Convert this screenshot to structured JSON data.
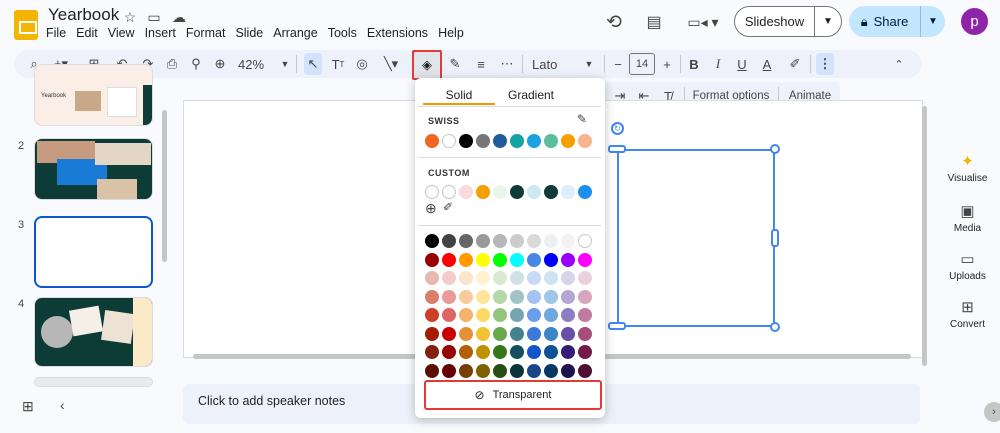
{
  "app": {
    "title": "Yearbook",
    "menu": [
      "File",
      "Edit",
      "View",
      "Insert",
      "Format",
      "Slide",
      "Arrange",
      "Tools",
      "Extensions",
      "Help"
    ]
  },
  "header": {
    "slideshow_label": "Slideshow",
    "share_label": "Share",
    "avatar_letter": "p"
  },
  "toolbar": {
    "zoom": "42%",
    "font": "Lato",
    "font_size": "14"
  },
  "ribbon": {
    "format_options": "Format options",
    "animate": "Animate"
  },
  "slides": {
    "numbers": [
      "2",
      "3",
      "4"
    ]
  },
  "notes": {
    "placeholder": "Click to add speaker notes"
  },
  "sidebar": {
    "items": [
      "Visualise",
      "Media",
      "Uploads",
      "Convert"
    ]
  },
  "color_popup": {
    "tab_solid": "Solid",
    "tab_gradient": "Gradient",
    "section_theme": "SWISS",
    "section_custom": "CUSTOM",
    "transparent_label": "Transparent",
    "theme_colors": [
      "#f26522",
      "#ffffff",
      "#000000",
      "#777777",
      "#1f5c99",
      "#14a3a3",
      "#1aa3e0",
      "#5cbd9b",
      "#f5a000",
      "#f7b48f"
    ],
    "custom_colors": [
      "#ffffff",
      "#ffffff",
      "#fadadd",
      "#f5a000",
      "#e8f5e9",
      "#0f3b3a",
      "#cfe9f1",
      "#0f3b3a",
      "#dbeefa",
      "#1a8ff0"
    ],
    "grid": [
      [
        "#000000",
        "#434343",
        "#666666",
        "#999999",
        "#b7b7b7",
        "#cccccc",
        "#d9d9d9",
        "#efefef",
        "#f3f3f3",
        "#ffffff"
      ],
      [
        "#980000",
        "#ff0000",
        "#ff9900",
        "#ffff00",
        "#00ff00",
        "#00ffff",
        "#4a86e8",
        "#0000ff",
        "#9900ff",
        "#ff00ff"
      ],
      [
        "#e6b8af",
        "#f4cccc",
        "#fce5cd",
        "#fff2cc",
        "#d9ead3",
        "#d0e0e3",
        "#c9daf8",
        "#cfe2f3",
        "#d9d2e9",
        "#ead1dc"
      ],
      [
        "#dd7e6b",
        "#ea9999",
        "#f9cb9c",
        "#ffe599",
        "#b6d7a8",
        "#a2c4c9",
        "#a4c2f4",
        "#9fc5e8",
        "#b4a7d6",
        "#d5a6bd"
      ],
      [
        "#cc4125",
        "#e06666",
        "#f6b26b",
        "#ffd966",
        "#93c47d",
        "#76a5af",
        "#6d9eeb",
        "#6fa8dc",
        "#8e7cc3",
        "#c27ba0"
      ],
      [
        "#a61c00",
        "#cc0000",
        "#e69138",
        "#f1c232",
        "#6aa84f",
        "#45818e",
        "#3c78d8",
        "#3d85c6",
        "#674ea7",
        "#a64d79"
      ],
      [
        "#85200c",
        "#990000",
        "#b45f06",
        "#bf9000",
        "#38761d",
        "#134f5c",
        "#1155cc",
        "#0b5394",
        "#351c75",
        "#741b47"
      ],
      [
        "#5b0f00",
        "#660000",
        "#783f04",
        "#7f6000",
        "#274e13",
        "#0c343d",
        "#1c4587",
        "#073763",
        "#20124d",
        "#4c1130"
      ]
    ]
  }
}
